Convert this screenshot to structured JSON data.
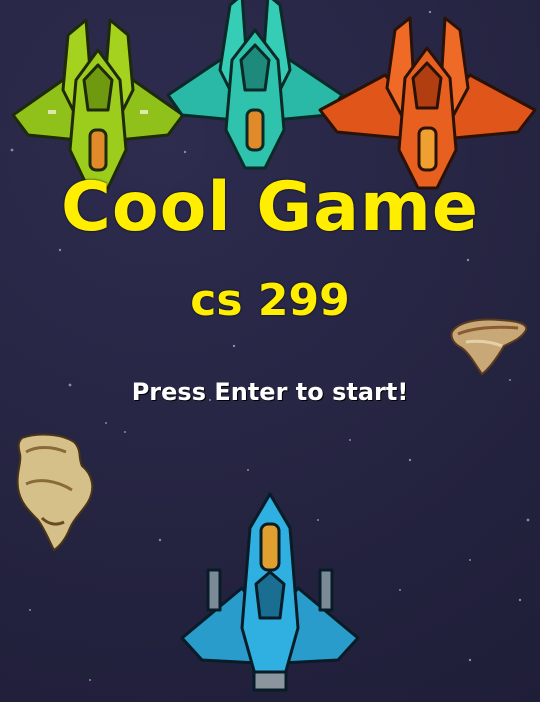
{
  "game": {
    "title": "Cool Game",
    "subtitle": "cs 299",
    "start_prompt": "Press Enter to start!"
  },
  "colors": {
    "background": "#252441",
    "title": "#ffee00",
    "prompt": "#ffffff",
    "ship_green": "#9ccc1c",
    "ship_teal": "#2ab9a6",
    "ship_orange": "#e0561a",
    "ship_player": "#2a9ccc",
    "asteroid": "#c9a878"
  },
  "sprites": {
    "enemy_ships": [
      "green-enemy-ship",
      "teal-enemy-ship",
      "orange-enemy-ship"
    ],
    "player_ship": "player-ship",
    "asteroids": [
      "asteroid-small",
      "asteroid-large"
    ]
  }
}
